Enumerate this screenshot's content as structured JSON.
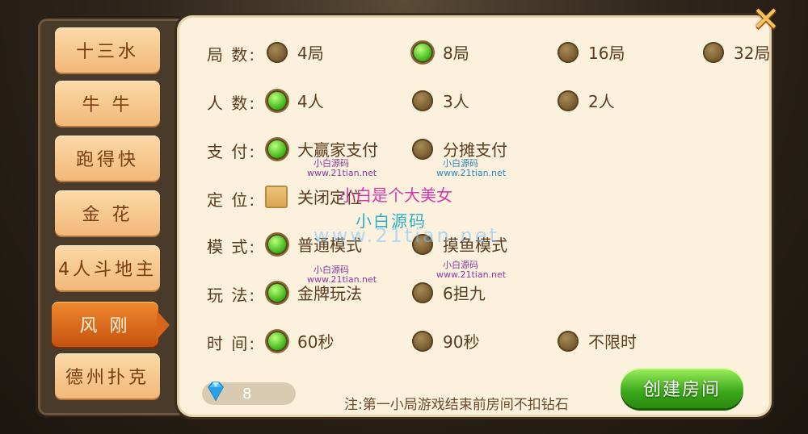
{
  "colors": {
    "panel_bg": "#fbf1dc",
    "tab_bg": "#f2b878",
    "tab_active_bg": "#d8661a",
    "radio_selected": "#3fb51a",
    "create_button": "#3aa81a"
  },
  "tabs": [
    {
      "label": "十三水",
      "active": false
    },
    {
      "label": "牛 牛",
      "active": false
    },
    {
      "label": "跑得快",
      "active": false
    },
    {
      "label": "金 花",
      "active": false
    },
    {
      "label": "4人斗地主",
      "active": false
    },
    {
      "label": "风 刚",
      "active": true
    },
    {
      "label": "德州扑克",
      "active": false
    }
  ],
  "settings": {
    "rounds": {
      "label": "局  数:",
      "options": [
        {
          "label": "4局",
          "selected": false
        },
        {
          "label": "8局",
          "selected": true
        },
        {
          "label": "16局",
          "selected": false
        },
        {
          "label": "32局",
          "selected": false
        }
      ]
    },
    "players": {
      "label": "人  数:",
      "options": [
        {
          "label": "4人",
          "selected": true
        },
        {
          "label": "3人",
          "selected": false
        },
        {
          "label": "2人",
          "selected": false
        }
      ]
    },
    "payment": {
      "label": "支  付:",
      "options": [
        {
          "label": "大赢家支付",
          "selected": true
        },
        {
          "label": "分摊支付",
          "selected": false
        }
      ]
    },
    "location": {
      "label": "定  位:",
      "options": [
        {
          "label": "关闭定位",
          "checked": false
        }
      ]
    },
    "mode": {
      "label": "模  式:",
      "options": [
        {
          "label": "普通模式",
          "selected": true
        },
        {
          "label": "摸鱼模式",
          "selected": false
        }
      ]
    },
    "play": {
      "label": "玩  法:",
      "options": [
        {
          "label": "金牌玩法",
          "selected": true
        },
        {
          "label": "6担九",
          "selected": false
        }
      ]
    },
    "time": {
      "label": "时  间:",
      "options": [
        {
          "label": "60秒",
          "selected": true
        },
        {
          "label": "90秒",
          "selected": false
        },
        {
          "label": "不限时",
          "selected": false
        }
      ]
    }
  },
  "footer": {
    "diamond_count": "8",
    "note": "注:第一小局游戏结束前房间不扣钻石",
    "create_button": "创建房间"
  },
  "watermarks": {
    "site": "www.21tian.net",
    "brand": "小白源码",
    "slogan": "小白是个大美女"
  },
  "icons": {
    "close": "close-x-icon",
    "diamond": "diamond-icon"
  }
}
